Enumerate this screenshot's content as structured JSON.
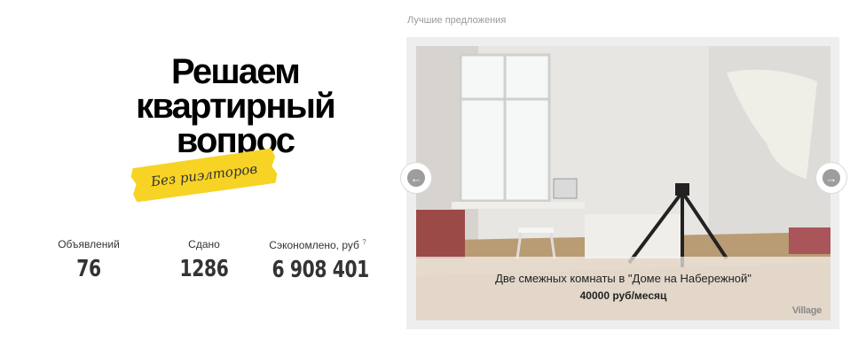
{
  "hero": {
    "title_lines": [
      "Решаем",
      "квартирный",
      "вопрос"
    ],
    "tape_label": "Без риэлторов",
    "tape_color": "#f7d325"
  },
  "stats": [
    {
      "label": "Объявлений",
      "value": "76"
    },
    {
      "label": "Сдано",
      "value": "1286"
    },
    {
      "label": "Сэкономлено, руб",
      "value": "6 908 401",
      "hint": "?"
    }
  ],
  "offers": {
    "section_label": "Лучшие предложения",
    "current": {
      "title": "Две смежных комнаты в \"Доме на Набережной\"",
      "price": "40000 руб/месяц",
      "watermark": "Village"
    },
    "prev_icon": "arrow-left-icon",
    "next_icon": "arrow-right-icon"
  }
}
